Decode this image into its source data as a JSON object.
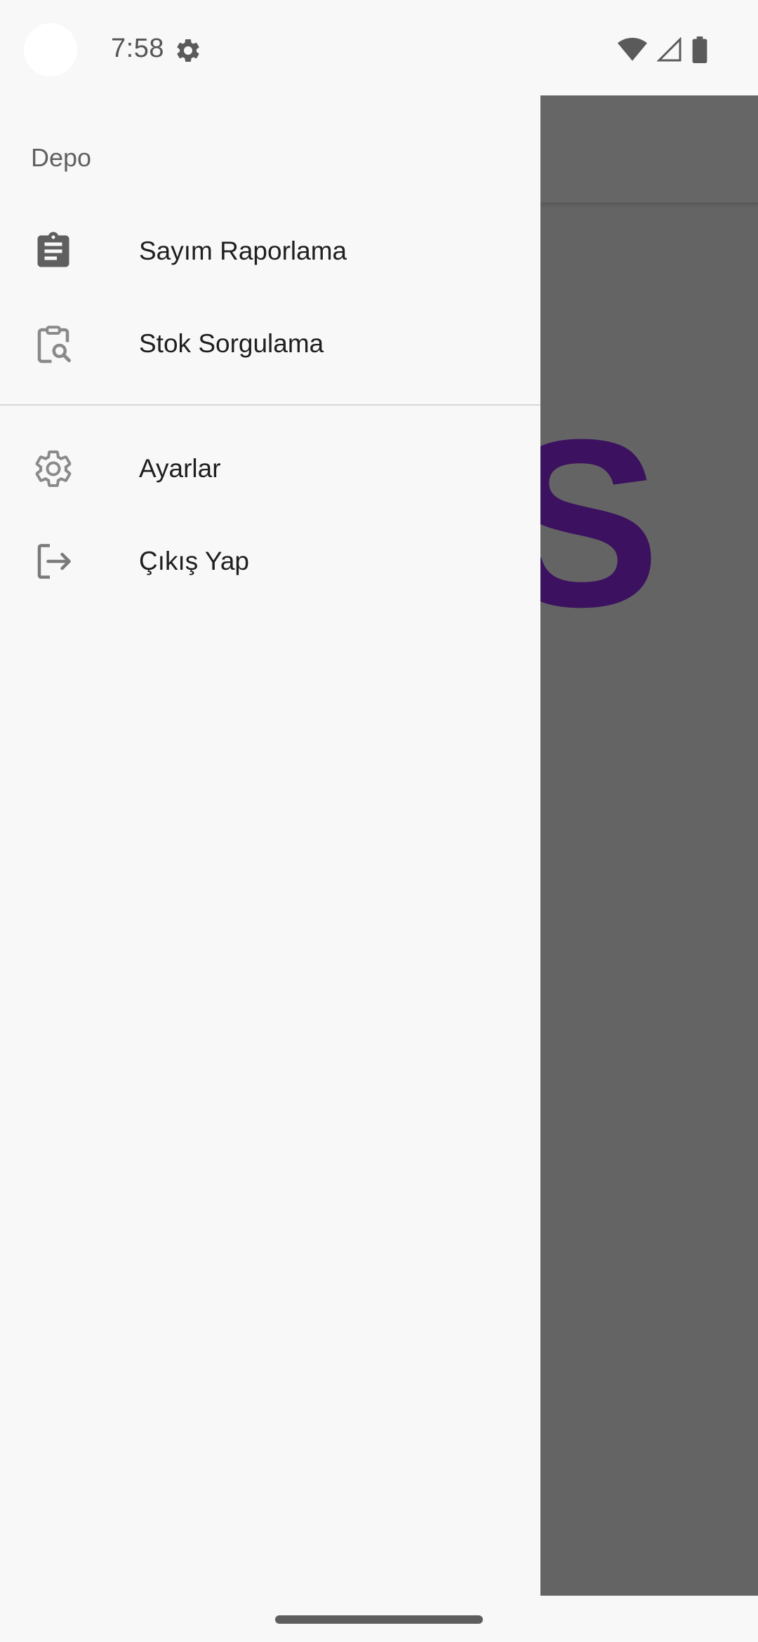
{
  "status_bar": {
    "time": "7:58",
    "icons": [
      "settings-gear-icon",
      "wifi-icon",
      "cellular-signal-icon",
      "battery-icon"
    ]
  },
  "background_app": {
    "logo_letter": "S",
    "logo_color": "#3b1160",
    "scrim_color": "#646464"
  },
  "drawer": {
    "header": "Depo",
    "groups": [
      {
        "items": [
          {
            "label": "Sayım Raporlama",
            "icon": "clipboard-report-icon"
          },
          {
            "label": "Stok Sorgulama",
            "icon": "clipboard-search-icon"
          }
        ]
      },
      {
        "items": [
          {
            "label": "Ayarlar",
            "icon": "settings-gear-icon"
          },
          {
            "label": "Çıkış Yap",
            "icon": "logout-icon"
          }
        ]
      }
    ]
  }
}
